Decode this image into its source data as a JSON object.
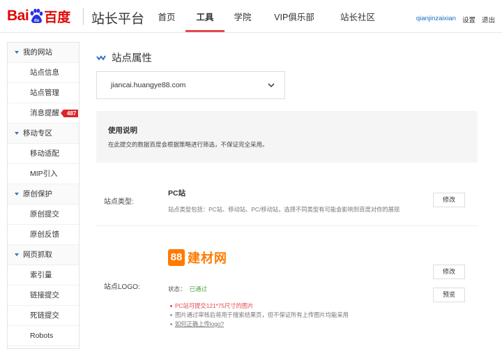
{
  "header": {
    "logo_text": "Bai",
    "logo_du": "du",
    "logo_cn": "百度",
    "platform": "站长平台",
    "nav": [
      "首页",
      "工具",
      "学院",
      "VIP俱乐部",
      "站长社区"
    ],
    "active_nav": "工具",
    "username": "qianjinzaixian",
    "settings": "设置",
    "logout": "退出"
  },
  "sidebar": {
    "groups": [
      {
        "label": "我的网站",
        "items": [
          {
            "label": "站点信息"
          },
          {
            "label": "站点管理"
          },
          {
            "label": "消息提醒",
            "badge": "487"
          }
        ]
      },
      {
        "label": "移动专区",
        "items": [
          {
            "label": "移动适配"
          },
          {
            "label": "MIP引入"
          }
        ]
      },
      {
        "label": "原创保护",
        "items": [
          {
            "label": "原创提交"
          },
          {
            "label": "原创反馈"
          }
        ]
      },
      {
        "label": "网页抓取",
        "items": [
          {
            "label": "索引量"
          },
          {
            "label": "链接提交"
          },
          {
            "label": "死链提交"
          },
          {
            "label": "Robots"
          }
        ]
      }
    ]
  },
  "main": {
    "section_title": "站点属性",
    "site_select_value": "jiancai.huangye88.com",
    "notice": {
      "title": "使用说明",
      "text": "在此提交的数据百度会根据策略进行筛选，不保证完全采用。"
    },
    "site_type": {
      "label": "站点类型:",
      "value": "PC站",
      "desc": "站点类型包括：PC站、移动站、PC/移动站，选择不同类型有可能会影响到百度对你的展现",
      "edit_button": "修改"
    },
    "site_logo": {
      "label": "站点LOGO:",
      "logo_mark": "88",
      "logo_brand": "建材网",
      "status_label": "状态：",
      "status_value": "已通过",
      "edit_button": "修改",
      "preview_button": "预览",
      "notes": [
        "PC站可提交121*75尺寸的图片",
        "图片通过审核后将用于搜索结果页，但不保证所有上传图片均能采用",
        "如何正确上传logo?"
      ]
    }
  },
  "colors": {
    "brand_red": "#e10601",
    "accent_blue": "#3b6ec9",
    "badge_red": "#d9262c",
    "logo_orange": "#ff7a00",
    "ok_green": "#4aa53a"
  }
}
